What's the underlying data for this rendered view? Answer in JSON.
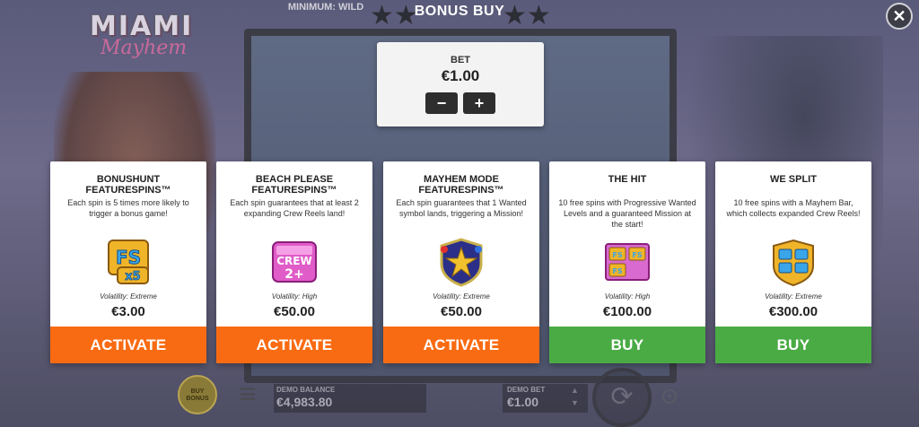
{
  "header": {
    "title": "BONUS BUY",
    "minimum_wild": "MINIMUM: WILD",
    "logo_top": "MIAMI",
    "logo_bottom": "Mayhem",
    "close_symbol": "✕",
    "close_icon": "close-icon"
  },
  "bet": {
    "label": "BET",
    "value": "€1.00",
    "decrease_label": "−",
    "increase_label": "+"
  },
  "cards": [
    {
      "title": "BONUSHUNT FEATURESPINS™",
      "description": "Each spin is 5 times more likely to trigger a bonus game!",
      "volatility": "Volatility: Extreme",
      "price": "€3.00",
      "button": "ACTIVATE",
      "button_color": "#f96b12",
      "icon": "fs-x5-badge-icon"
    },
    {
      "title": "BEACH PLEASE FEATURESPINS™",
      "description": "Each spin guarantees that at least 2 expanding Crew Reels land!",
      "volatility": "Volatility: High",
      "price": "€50.00",
      "button": "ACTIVATE",
      "button_color": "#f96b12",
      "icon": "crew-2-plus-badge-icon"
    },
    {
      "title": "MAYHEM MODE FEATURESPINS™",
      "description": "Each spin guarantees that 1 Wanted symbol lands, triggering a Mission!",
      "volatility": "Volatility: Extreme",
      "price": "€50.00",
      "button": "ACTIVATE",
      "button_color": "#f96b12",
      "icon": "star-shield-badge-icon"
    },
    {
      "title": "THE HIT",
      "description": "10 free spins with Progressive Wanted Levels and a guaranteed Mission at the start!",
      "volatility": "Volatility: High",
      "price": "€100.00",
      "button": "BUY",
      "button_color": "#4aab45",
      "icon": "fs-tickets-badge-icon"
    },
    {
      "title": "WE SPLIT",
      "description": "10 free spins with a Mayhem Bar, which collects expanded Crew Reels!",
      "volatility": "Volatility: Extreme",
      "price": "€300.00",
      "button": "BUY",
      "button_color": "#4aab45",
      "icon": "fs-shield-badge-icon"
    }
  ],
  "footer": {
    "buy_bonus": "BUY BONUS",
    "demo_balance_label": "DEMO BALANCE",
    "demo_balance_value": "€4,983.80",
    "demo_bet_label": "DEMO BET",
    "demo_bet_value": "€1.00"
  },
  "colors": {
    "activate": "#f96b12",
    "buy": "#4aab45",
    "panel": "#ffffff"
  }
}
